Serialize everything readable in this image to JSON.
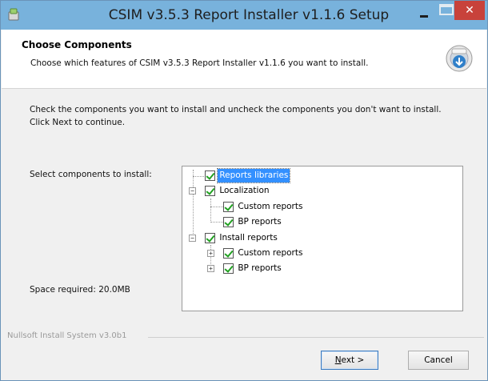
{
  "window": {
    "title": "CSIM v3.5.3 Report Installer v1.1.6 Setup",
    "close_glyph": "✕"
  },
  "header": {
    "title": "Choose Components",
    "subtitle": "Choose which features of CSIM v3.5.3 Report Installer v1.1.6 you want to install."
  },
  "body": {
    "description": "Check the components you want to install and uncheck the components you don't want to install. Click Next to continue.",
    "select_label": "Select components to install:",
    "space_required": "Space required: 20.0MB"
  },
  "components": {
    "reports_libraries": "Reports libraries",
    "localization": "Localization",
    "localization_custom": "Custom reports",
    "localization_bp": "BP reports",
    "install_reports": "Install reports",
    "install_custom": "Custom reports",
    "install_bp": "BP reports"
  },
  "footer": {
    "branding": "Nullsoft Install System v3.0b1",
    "next_mnemonic": "N",
    "next_rest": "ext >",
    "cancel_label": "Cancel"
  },
  "colors": {
    "titlebar": "#78b2dc",
    "close": "#c8423b",
    "selection": "#3390ff",
    "check": "#21a121"
  }
}
